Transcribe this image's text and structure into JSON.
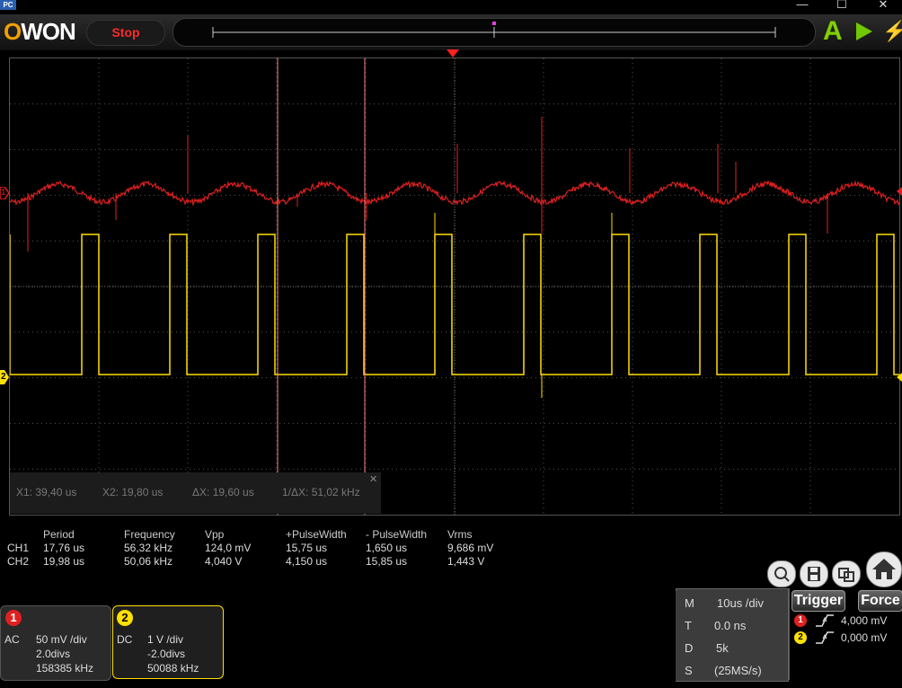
{
  "titlebar": {
    "app_icon": "PC",
    "minimize": "—",
    "maximize": "☐",
    "close": "✕"
  },
  "toolbar": {
    "logo": "OWON",
    "stop_label": "Stop",
    "auto_label": "A"
  },
  "cursors": {
    "x1": "X1: 39,40 us",
    "x2": "X2: 19,80 us",
    "dx": "ΔX: 19,60 us",
    "inv_dx": "1/ΔX: 51,02 kHz",
    "close": "✕"
  },
  "measurements": {
    "headers": [
      "Period",
      "Frequency",
      "Vpp",
      "+PulseWidth",
      "- PulseWidth",
      "Vrms"
    ],
    "rows": [
      {
        "ch": "CH1",
        "values": [
          "17,76 us",
          "56,32 kHz",
          "124,0 mV",
          "15,75 us",
          "1,650 us",
          "9,686 mV"
        ]
      },
      {
        "ch": "CH2",
        "values": [
          "19,98 us",
          "50,06 kHz",
          "4,040 V",
          "4,150 us",
          "15,85 us",
          "1,443 V"
        ]
      }
    ]
  },
  "channels": [
    {
      "num": "1",
      "coupling": "AC",
      "scale": "50 mV /div",
      "offset": "2.0divs",
      "freq": "158385 kHz",
      "color": "#e02020"
    },
    {
      "num": "2",
      "coupling": "DC",
      "scale": "1 V /div",
      "offset": "-2.0divs",
      "freq": "50088 kHz",
      "color": "#ffe000"
    }
  ],
  "timebase": {
    "rows": [
      {
        "key": "M",
        "value": "10us /div"
      },
      {
        "key": "T",
        "value": "0.0 ns"
      },
      {
        "key": "D",
        "value": "5k"
      },
      {
        "key": "S",
        "value": "(25MS/s)"
      }
    ]
  },
  "trigger": {
    "trigger_label": "Trigger",
    "force_label": "Force",
    "levels": [
      {
        "ch": "1",
        "value": "4,000 mV"
      },
      {
        "ch": "2",
        "value": "0,000 mV"
      }
    ]
  },
  "markers": {
    "ch1": "1",
    "ch2": "2"
  },
  "colors": {
    "ch1": "#e02020",
    "ch2": "#ffe000",
    "cursor": "#ff8080",
    "trigger": "#ff2020"
  }
}
